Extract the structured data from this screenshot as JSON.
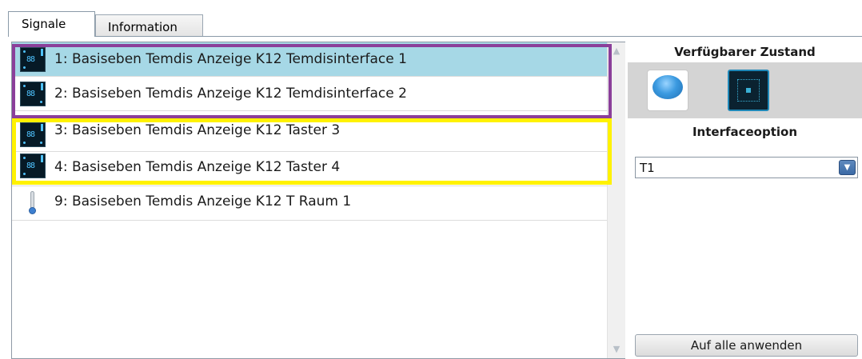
{
  "tabs": [
    {
      "label": "Signale",
      "active": true
    },
    {
      "label": "Information",
      "active": false
    }
  ],
  "signals": [
    {
      "label": "1: Basiseben Temdis Anzeige K12 Temdisinterface 1",
      "icon": "temdis-display-icon",
      "selected": true
    },
    {
      "label": "2: Basiseben Temdis Anzeige K12 Temdisinterface 2",
      "icon": "temdis-display-icon",
      "selected": false
    },
    {
      "label": "3: Basiseben Temdis Anzeige K12 Taster 3",
      "icon": "temdis-display-icon",
      "selected": false
    },
    {
      "label": "4: Basiseben Temdis Anzeige K12 Taster 4",
      "icon": "temdis-display-icon",
      "selected": false
    },
    {
      "label": "9: Basiseben Temdis Anzeige K12 T Raum 1",
      "icon": "thermometer-icon",
      "selected": false
    }
  ],
  "icon_digits": "88",
  "scroll": {
    "up": "▲",
    "down": "▼"
  },
  "right_panel": {
    "available_state_title": "Verfügbarer Zustand",
    "states": [
      {
        "icon": "blue-pushbutton-icon"
      },
      {
        "icon": "temdis-interface-state-icon",
        "selected": true
      }
    ],
    "interface_option_title": "Interfaceoption",
    "interface_option_value": "T1",
    "dropdown_arrow": "▼",
    "apply_all_label": "Auf alle anwenden"
  },
  "colors": {
    "selection": "#a6d8e6",
    "highlight_purple": "#8b3f9a",
    "highlight_yellow": "#fff200"
  }
}
